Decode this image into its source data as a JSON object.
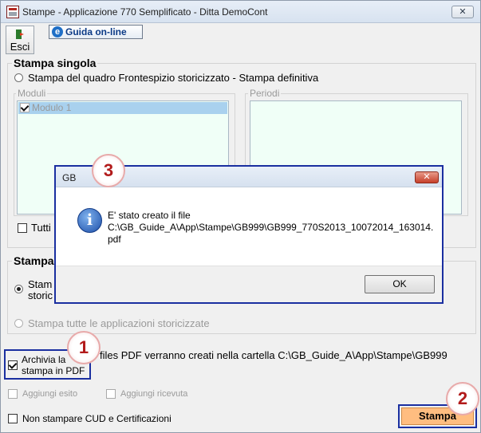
{
  "window": {
    "title": "Stampe - Applicazione 770 Semplificato - Ditta  DemoCont",
    "close_glyph": "✕"
  },
  "toolbar": {
    "exit_label": "Esci",
    "help_label": "Guida on-line",
    "help_icon": "e"
  },
  "single_print": {
    "title": "Stampa singola",
    "radio_label": "Stampa del quadro Frontespizio storicizzato - Stampa definitiva",
    "modules": {
      "title": "Moduli",
      "items": [
        {
          "label": "Modulo 1",
          "checked": true
        }
      ]
    },
    "periods": {
      "title": "Periodi"
    },
    "all_checkbox_label": "Tutti"
  },
  "multi_print": {
    "title": "Stampa",
    "radio_selected_label_line1": "Stam",
    "radio_selected_label_line2": "storic",
    "radio_all_label": "Stampa tutte le applicazioni storicizzate"
  },
  "archive": {
    "checkbox_label_line1": "Archivia la",
    "checkbox_label_line2": "stampa in PDF",
    "checked": true,
    "info_text": "files PDF verranno creati nella cartella C:\\GB_Guide_A\\App\\Stampe\\GB999"
  },
  "options": {
    "add_outcome": "Aggiungi esito",
    "add_receipt": "Aggiungi ricevuta",
    "no_cud": "Non stampare CUD e Certificazioni"
  },
  "print_button_label": "Stampa",
  "badges": {
    "one": "1",
    "two": "2",
    "three": "3"
  },
  "dialog": {
    "title": "GB",
    "close_glyph": "✕",
    "icon_glyph": "i",
    "message_line1": "E' stato creato il file",
    "message_line2": "C:\\GB_Guide_A\\App\\Stampe\\GB999\\GB999_770S2013_10072014_163014.",
    "message_line3": "pdf",
    "ok_label": "OK"
  },
  "colors": {
    "annotation_border": "#1a2fa0",
    "badge_text": "#b21b1b",
    "print_button": "#ffbd80",
    "list_background": "#f0fff7",
    "list_selected": "#a9d1ee"
  }
}
